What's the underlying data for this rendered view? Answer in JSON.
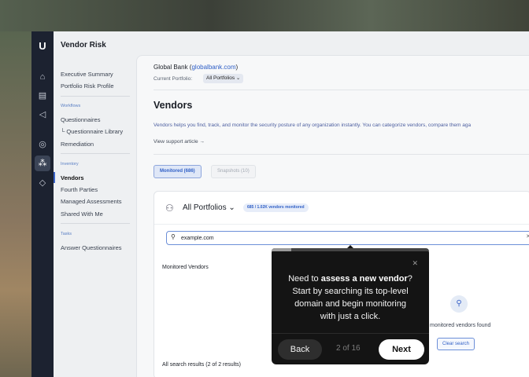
{
  "app": {
    "title": "Vendor Risk",
    "logo": "U"
  },
  "rail_icons": [
    "home-icon",
    "document-icon",
    "megaphone-icon",
    "target-icon",
    "vendors-icon",
    "shield-icon"
  ],
  "sidebar": {
    "top_items": [
      "Executive Summary",
      "Portfolio Risk Profile"
    ],
    "workflows_label": "Workflows",
    "workflows_items": [
      "Questionnaires",
      "└ Questionnaire Library",
      "Remediation"
    ],
    "inventory_label": "Inventory",
    "inventory_items": [
      "Vendors",
      "Fourth Parties",
      "Managed Assessments",
      "Shared With Me"
    ],
    "tasks_label": "Tasks",
    "tasks_items": [
      "Answer Questionnaires"
    ]
  },
  "org": {
    "name": "Global Bank (",
    "domain": "globalbank.com",
    "close": ")",
    "portfolio_label": "Current Portfolio:",
    "portfolio_value": "All Portfolios ⌄"
  },
  "page": {
    "title": "Vendors",
    "description": "Vendors helps you find, track, and monitor the security posture of any organization instantly. You can categorize vendors, compare them aga",
    "support_link": "View support article  →"
  },
  "tabs": [
    {
      "label": "Monitored (686)",
      "active": true
    },
    {
      "label": "Snapshots (10)",
      "active": false
    }
  ],
  "card": {
    "portfolio_title": "All Portfolios ⌄",
    "portfolio_badge": "685 / 1.02K vendors monitored",
    "search_value": "example.com",
    "monitored_heading": "Monitored Vendors",
    "empty_text": "monitored vendors found",
    "clear_button": "Clear search",
    "all_results": "All search results (2 of 2 results)"
  },
  "tour": {
    "msg_prefix": "Need to ",
    "msg_bold": "assess a new vendor",
    "msg_suffix": "? Start by searching its top-level domain and begin monitoring with just a click.",
    "back": "Back",
    "counter": "2 of 16",
    "next": "Next",
    "progress_fraction": 0.125
  },
  "colors": {
    "accent": "#2f5fc6",
    "rail": "#1c2230",
    "tooltip": "#141414"
  }
}
